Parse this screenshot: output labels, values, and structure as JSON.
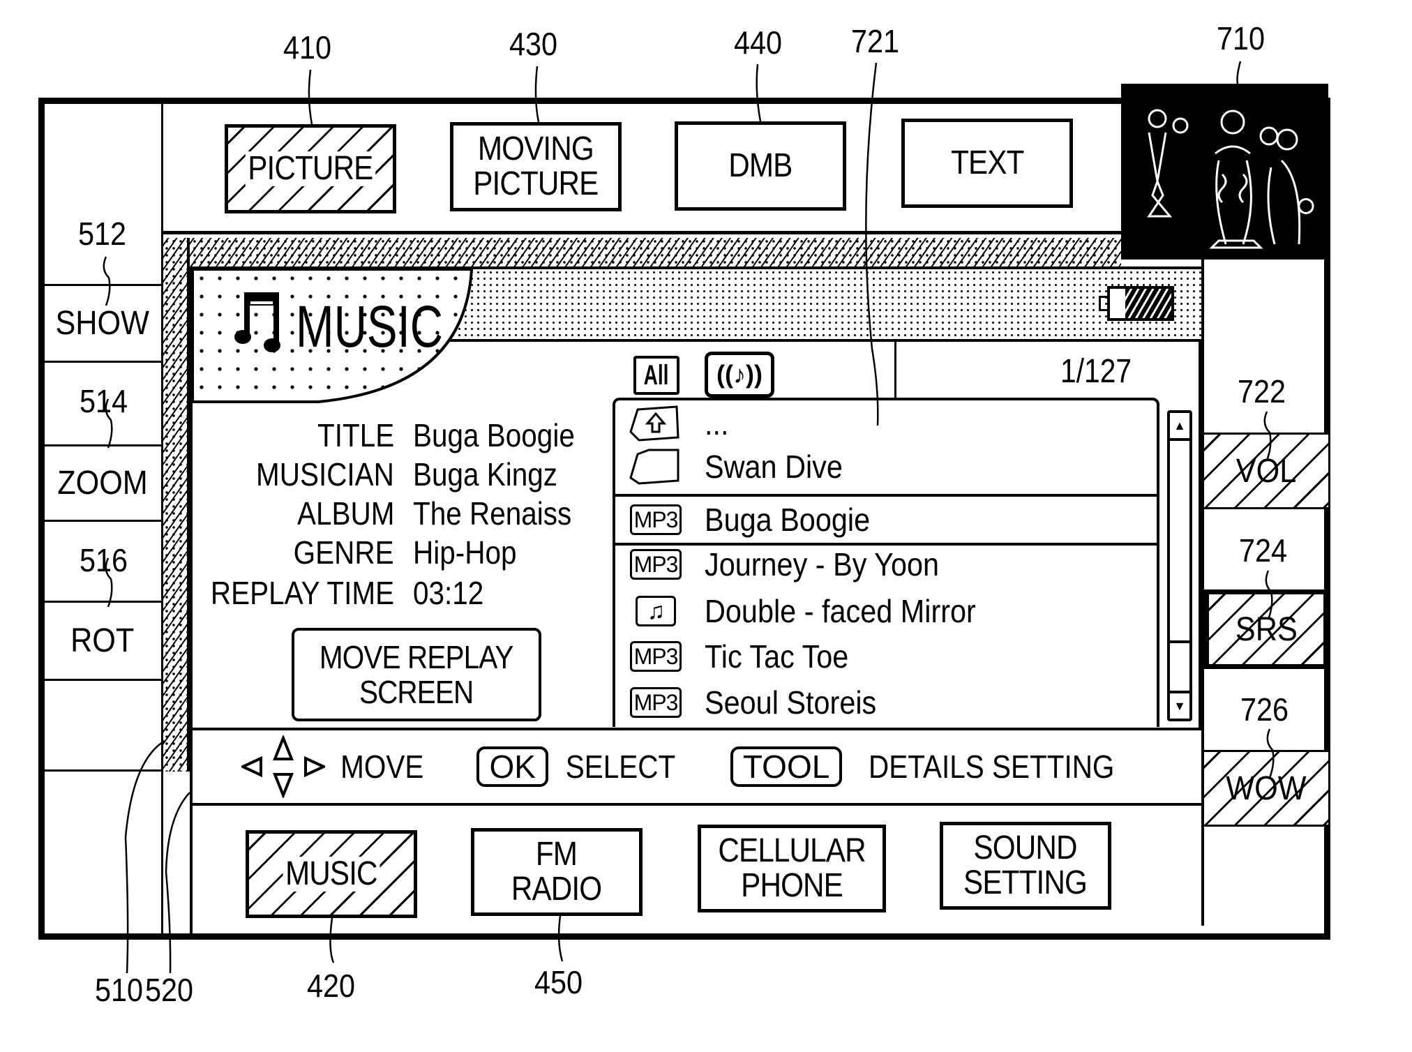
{
  "reference_numerals": {
    "picture": "410",
    "moving_picture": "430",
    "dmb": "440",
    "list_box": "721",
    "thumbnail": "710",
    "show": "512",
    "zoom": "514",
    "rot": "516",
    "vol": "722",
    "srs": "724",
    "wow": "726",
    "left_panel": "510",
    "hatched_border": "520",
    "music": "420",
    "fm_radio": "450"
  },
  "top_menu": [
    {
      "label": "PICTURE",
      "selected": true
    },
    {
      "label": "MOVING\nPICTURE",
      "selected": false
    },
    {
      "label": "DMB",
      "selected": false
    },
    {
      "label": "TEXT",
      "selected": false
    }
  ],
  "left_menu": [
    {
      "label": "SHOW"
    },
    {
      "label": "ZOOM"
    },
    {
      "label": "ROT"
    }
  ],
  "right_menu": [
    {
      "label": "VOL",
      "selected": true
    },
    {
      "label": "SRS",
      "selected": true,
      "emphasized": true
    },
    {
      "label": "WOW",
      "selected": true
    }
  ],
  "music_panel": {
    "title": "MUSIC",
    "title_icon": "music-note-icon",
    "battery_level": 0.75,
    "track_info": [
      {
        "label": "TITLE",
        "value": "Buga Boogie"
      },
      {
        "label": "MUSICIAN",
        "value": "Buga Kingz"
      },
      {
        "label": "ALBUM",
        "value": "The Renaiss"
      },
      {
        "label": "GENRE",
        "value": "Hip-Hop"
      },
      {
        "label": "REPLAY TIME",
        "value": "03:12"
      }
    ],
    "move_replay_button": "MOVE REPLAY\nSCREEN",
    "repeat_icon_label": "All",
    "counter": "1/127",
    "list": [
      {
        "icon": "folder-up-icon",
        "label": "...",
        "selected": false
      },
      {
        "icon": "folder-icon",
        "label": "Swan Dive",
        "selected": false
      },
      {
        "icon": "mp3-icon",
        "icon_text": "MP3",
        "label": "Buga Boogie",
        "selected": true
      },
      {
        "icon": "mp3-icon",
        "icon_text": "MP3",
        "label": "Journey - By Yoon",
        "selected": false
      },
      {
        "icon": "music-file-icon",
        "label": "Double - faced Mirror",
        "selected": false
      },
      {
        "icon": "mp3-icon",
        "icon_text": "MP3",
        "label": "Tic Tac Toe",
        "selected": false
      },
      {
        "icon": "mp3-icon",
        "icon_text": "MP3",
        "label": "Seoul Storeis",
        "selected": false
      }
    ],
    "footer": {
      "move": "MOVE",
      "ok_key": "OK",
      "select": "SELECT",
      "tool_key": "TOOL",
      "details": "DETAILS SETTING"
    }
  },
  "bottom_menu": [
    {
      "label": "MUSIC",
      "selected": true
    },
    {
      "label": "FM\nRADIO",
      "selected": false
    },
    {
      "label": "CELLULAR\nPHONE",
      "selected": false
    },
    {
      "label": "SOUND\nSETTING",
      "selected": false
    }
  ]
}
